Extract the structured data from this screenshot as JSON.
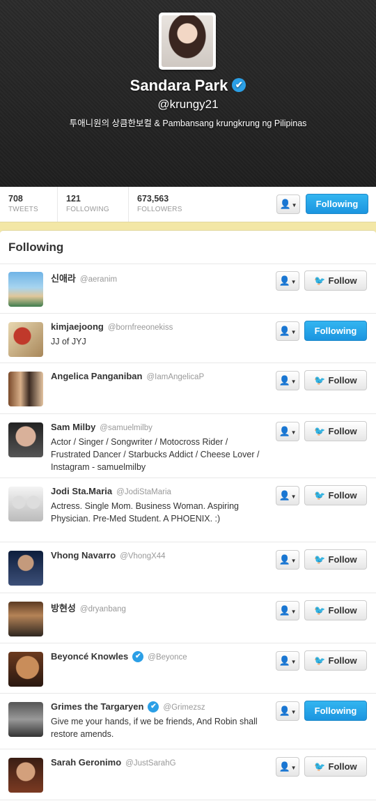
{
  "profile": {
    "name": "Sandara Park",
    "handle": "@krungy21",
    "bio": "투애니원의 상큼한보컬 & Pambansang krungkrung ng Pilipinas"
  },
  "stats": [
    {
      "value": "708",
      "label": "TWEETS"
    },
    {
      "value": "121",
      "label": "FOLLOWING"
    },
    {
      "value": "673,563",
      "label": "FOLLOWERS"
    }
  ],
  "header_actions": {
    "following_label": "Following"
  },
  "section_title": "Following",
  "labels": {
    "follow": "Follow",
    "following": "Following"
  },
  "users": [
    {
      "name": "신애라",
      "handle": "@aeranim",
      "bio": "",
      "verified": false,
      "state": "follow"
    },
    {
      "name": "kimjaejoong",
      "handle": "@bornfreeonekiss",
      "bio": "JJ of JYJ",
      "verified": false,
      "state": "following"
    },
    {
      "name": "Angelica Panganiban",
      "handle": "@IamAngelicaP",
      "bio": "",
      "verified": false,
      "state": "follow"
    },
    {
      "name": "Sam Milby",
      "handle": "@samuelmilby",
      "bio": "Actor / Singer / Songwriter / Motocross Rider / Frustrated Dancer / Starbucks Addict / Cheese Lover / Instagram - samuelmilby",
      "verified": false,
      "state": "follow"
    },
    {
      "name": "Jodi Sta.Maria",
      "handle": "@JodiStaMaria",
      "bio": "Actress. Single Mom. Business Woman. Aspiring Physician. Pre-Med Student. A PHOENIX. :)",
      "verified": false,
      "state": "follow"
    },
    {
      "name": "Vhong Navarro",
      "handle": "@VhongX44",
      "bio": "",
      "verified": false,
      "state": "follow"
    },
    {
      "name": "방현성",
      "handle": "@dryanbang",
      "bio": "",
      "verified": false,
      "state": "follow"
    },
    {
      "name": "Beyoncé Knowles",
      "handle": "@Beyonce",
      "bio": "",
      "verified": true,
      "state": "follow"
    },
    {
      "name": "Grimes the Targaryen",
      "handle": "@Grimezsz",
      "bio": "Give me your hands, if we be friends, And Robin shall restore amends.",
      "verified": true,
      "state": "following"
    },
    {
      "name": "Sarah Geronimo",
      "handle": "@JustSarahG",
      "bio": "",
      "verified": false,
      "state": "follow"
    }
  ]
}
